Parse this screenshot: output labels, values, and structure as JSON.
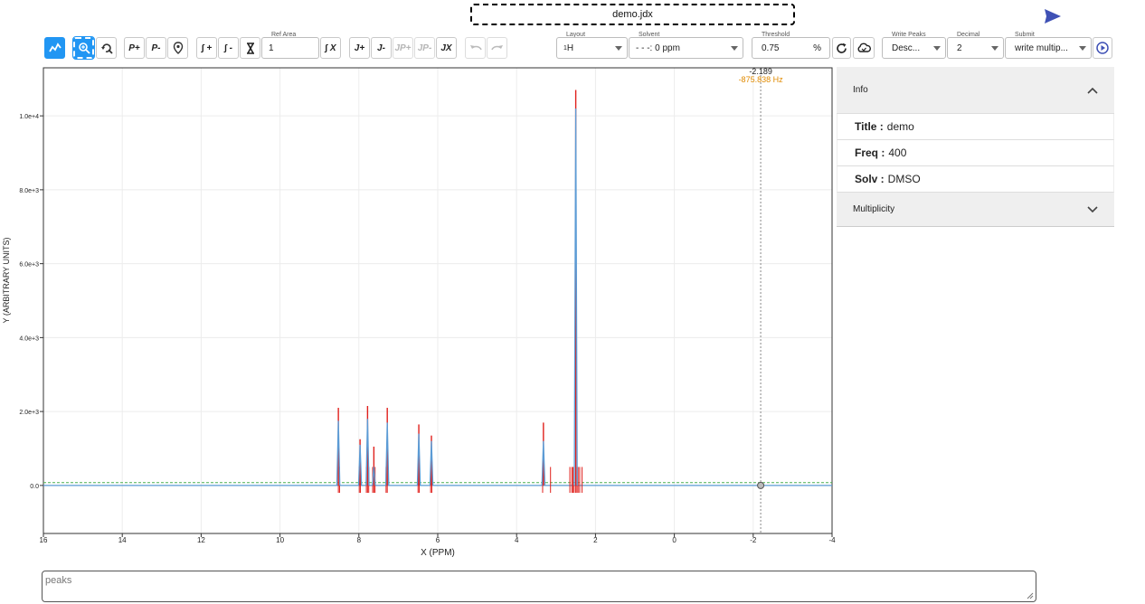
{
  "file": {
    "name": "demo.jdx"
  },
  "toolbar": {
    "peak_add": "P+",
    "peak_remove": "P-",
    "integrate_add": "∫ +",
    "integrate_remove": "∫ -",
    "ref_area_label": "Ref Area",
    "ref_area_value": "1",
    "integrate_reset": "∫ X",
    "j_add": "J+",
    "j_remove": "J-",
    "jp_add": "JP+",
    "jp_remove": "JP-",
    "j_reset": "JX"
  },
  "controls": {
    "layout": {
      "label": "Layout",
      "value_sup": "1",
      "value": "H"
    },
    "solvent": {
      "label": "Solvent",
      "value": "- - -: 0 ppm"
    },
    "threshold": {
      "label": "Threshold",
      "value": "0.75",
      "unit": "%"
    },
    "write_peaks": {
      "label": "Write Peaks",
      "value": "Desc..."
    },
    "decimal": {
      "label": "Decimal",
      "value": "2"
    },
    "submit": {
      "label": "Submit",
      "value": "write multip..."
    }
  },
  "cursor_readout": {
    "ppm": "-2.189",
    "hz": "-875.838 Hz"
  },
  "info": {
    "header": "Info",
    "rows": [
      {
        "label": "Title :",
        "value": "demo"
      },
      {
        "label": "Freq :",
        "value": "400"
      },
      {
        "label": "Solv :",
        "value": "DMSO"
      }
    ],
    "multiplicity_header": "Multiplicity"
  },
  "peaks_box": {
    "placeholder": "peaks"
  },
  "colors": {
    "accent": "#2196f3",
    "spectrum": "#5b9bd5",
    "peaks": "#e0201c",
    "threshold": "#4caf50",
    "readout": "#e08a00"
  },
  "chart_data": {
    "type": "line",
    "xlabel": "X (PPM)",
    "ylabel": "Y (ARBITRARY UNITS)",
    "xlim": [
      16,
      -4
    ],
    "ylim": [
      -1300,
      11300
    ],
    "x_ticks": [
      16,
      14,
      12,
      10,
      8,
      6,
      4,
      2,
      0,
      -2,
      -4
    ],
    "y_ticks": [
      0,
      2000,
      4000,
      6000,
      8000,
      10000
    ],
    "y_tick_labels": [
      "0.0",
      "2.0e+3",
      "4.0e+3",
      "6.0e+3",
      "8.0e+3",
      "1.0e+4"
    ],
    "grid": true,
    "cursor_x": -2.19,
    "baseline": 0,
    "threshold_y": 75,
    "series": [
      {
        "peaks": [
          {
            "x": 8.52,
            "y": 1750,
            "top": 2100
          },
          {
            "x": 7.97,
            "y": 1100,
            "top": 1250
          },
          {
            "x": 7.78,
            "y": 1800,
            "top": 2150
          },
          {
            "x": 7.62,
            "y": 500,
            "top": 1050
          },
          {
            "x": 7.28,
            "y": 1700,
            "top": 2100
          },
          {
            "x": 6.48,
            "y": 1400,
            "top": 1650
          },
          {
            "x": 6.16,
            "y": 1200,
            "top": 1350
          },
          {
            "x": 3.32,
            "y": 1200,
            "top": 1700
          },
          {
            "x": 2.5,
            "y": 10200,
            "top": 10700
          }
        ]
      }
    ],
    "peak_marker_x": [
      8.52,
      8.49,
      7.99,
      7.96,
      7.81,
      7.78,
      7.75,
      7.65,
      7.62,
      7.59,
      7.31,
      7.28,
      6.5,
      6.47,
      6.18,
      6.15,
      3.34,
      3.14,
      2.65,
      2.6,
      2.57,
      2.54,
      2.5,
      2.47,
      2.44,
      2.4,
      2.34
    ]
  }
}
